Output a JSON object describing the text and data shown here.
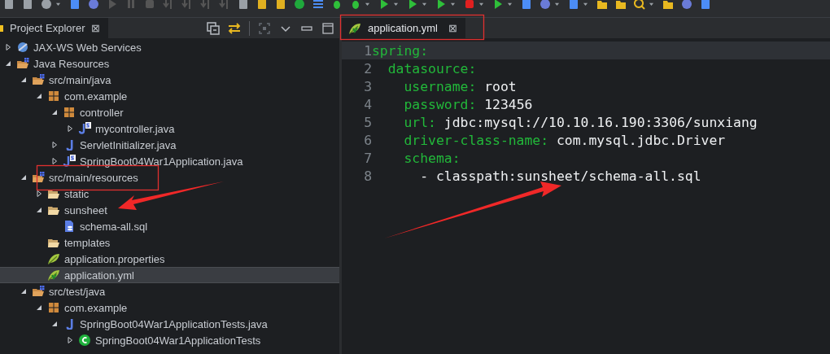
{
  "explorer": {
    "title": "Project Explorer",
    "close": "⊠",
    "selected": true
  },
  "tree": [
    {
      "label": "JAX-WS Web Services",
      "kind": "webservice",
      "expanded": false,
      "selected": false
    },
    {
      "label": "Java Resources",
      "kind": "project",
      "expanded": true,
      "selected": false,
      "children": [
        {
          "label": "src/main/java",
          "kind": "srcfolder",
          "expanded": true,
          "selected": false,
          "children": [
            {
              "label": "com.example",
              "kind": "package",
              "expanded": true,
              "selected": false,
              "children": [
                {
                  "label": "controller",
                  "kind": "package",
                  "expanded": true,
                  "selected": false,
                  "children": [
                    {
                      "label": "mycontroller.java",
                      "kind": "springjava",
                      "expanded": false,
                      "selected": false
                    }
                  ]
                },
                {
                  "label": "ServletInitializer.java",
                  "kind": "java",
                  "expanded": false,
                  "selected": false
                },
                {
                  "label": "SpringBoot04War1Application.java",
                  "kind": "springjava",
                  "expanded": false,
                  "selected": false
                }
              ]
            }
          ]
        },
        {
          "label": "src/main/resources",
          "kind": "srcfolder",
          "expanded": true,
          "selected": false,
          "children": [
            {
              "label": "static",
              "kind": "folder",
              "expanded": false,
              "selected": false
            },
            {
              "label": "sunsheet",
              "kind": "folder",
              "expanded": true,
              "selected": false,
              "children": [
                {
                  "label": "schema-all.sql",
                  "kind": "sql",
                  "selected": false
                }
              ]
            },
            {
              "label": "templates",
              "kind": "folder",
              "selected": false
            },
            {
              "label": "application.properties",
              "kind": "spring",
              "selected": false
            },
            {
              "label": "application.yml",
              "kind": "springyml",
              "selected": true
            }
          ]
        },
        {
          "label": "src/test/java",
          "kind": "srcfolder",
          "expanded": true,
          "selected": false,
          "children": [
            {
              "label": "com.example",
              "kind": "package",
              "expanded": true,
              "selected": false,
              "children": [
                {
                  "label": "SpringBoot04War1ApplicationTests.java",
                  "kind": "java",
                  "expanded": true,
                  "selected": false,
                  "children": [
                    {
                      "label": "SpringBoot04War1ApplicationTests",
                      "kind": "class",
                      "expanded": false,
                      "selected": false
                    }
                  ]
                }
              ]
            }
          ]
        }
      ]
    }
  ],
  "editor": {
    "tab": {
      "label": "application.yml",
      "close": "⊠",
      "selected": true
    },
    "lines": [
      {
        "number": "1",
        "current": true,
        "segments": [
          {
            "kind": "key",
            "text": "spring:"
          }
        ]
      },
      {
        "number": "2",
        "current": false,
        "segments": [
          {
            "kind": "key",
            "text": "  datasource:"
          }
        ]
      },
      {
        "number": "3",
        "current": false,
        "segments": [
          {
            "kind": "key",
            "text": "    username:"
          },
          {
            "kind": "value",
            "text": " root"
          }
        ]
      },
      {
        "number": "4",
        "current": false,
        "segments": [
          {
            "kind": "key",
            "text": "    password:"
          },
          {
            "kind": "value",
            "text": " 123456"
          }
        ]
      },
      {
        "number": "5",
        "current": false,
        "segments": [
          {
            "kind": "key",
            "text": "    url:"
          },
          {
            "kind": "value",
            "text": " jdbc:mysql://10.10.16.190:3306/sunxiang"
          }
        ]
      },
      {
        "number": "6",
        "current": false,
        "segments": [
          {
            "kind": "key",
            "text": "    driver-class-name:"
          },
          {
            "kind": "value",
            "text": " com.mysql.jdbc.Driver"
          }
        ]
      },
      {
        "number": "7",
        "current": false,
        "segments": [
          {
            "kind": "key",
            "text": "    schema:"
          }
        ]
      },
      {
        "number": "8",
        "current": false,
        "segments": [
          {
            "kind": "value",
            "text": "      - classpath:sunsheet/schema-all.sql"
          }
        ]
      }
    ]
  }
}
